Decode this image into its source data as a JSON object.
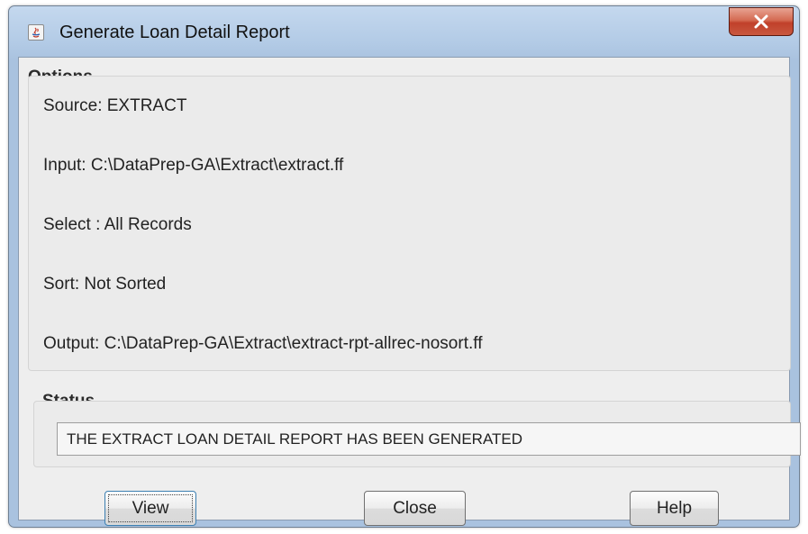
{
  "window": {
    "title": "Generate Loan Detail Report"
  },
  "options": {
    "heading": "Options",
    "source": "Source:  EXTRACT",
    "input": "Input:   C:\\DataPrep-GA\\Extract\\extract.ff",
    "select": "Select : All Records",
    "sort": "Sort:    Not Sorted",
    "output": "Output:  C:\\DataPrep-GA\\Extract\\extract-rpt-allrec-nosort.ff"
  },
  "status": {
    "heading": "Status",
    "message": "THE EXTRACT LOAN DETAIL REPORT HAS BEEN GENERATED"
  },
  "buttons": {
    "view": "View",
    "close": "Close",
    "help": "Help"
  },
  "icons": {
    "app": "java-app-icon",
    "window_close": "close-icon"
  },
  "colors": {
    "titlebar": "#b3cbe6",
    "close_button": "#c9583f",
    "dialog_background": "#eeeeee"
  }
}
